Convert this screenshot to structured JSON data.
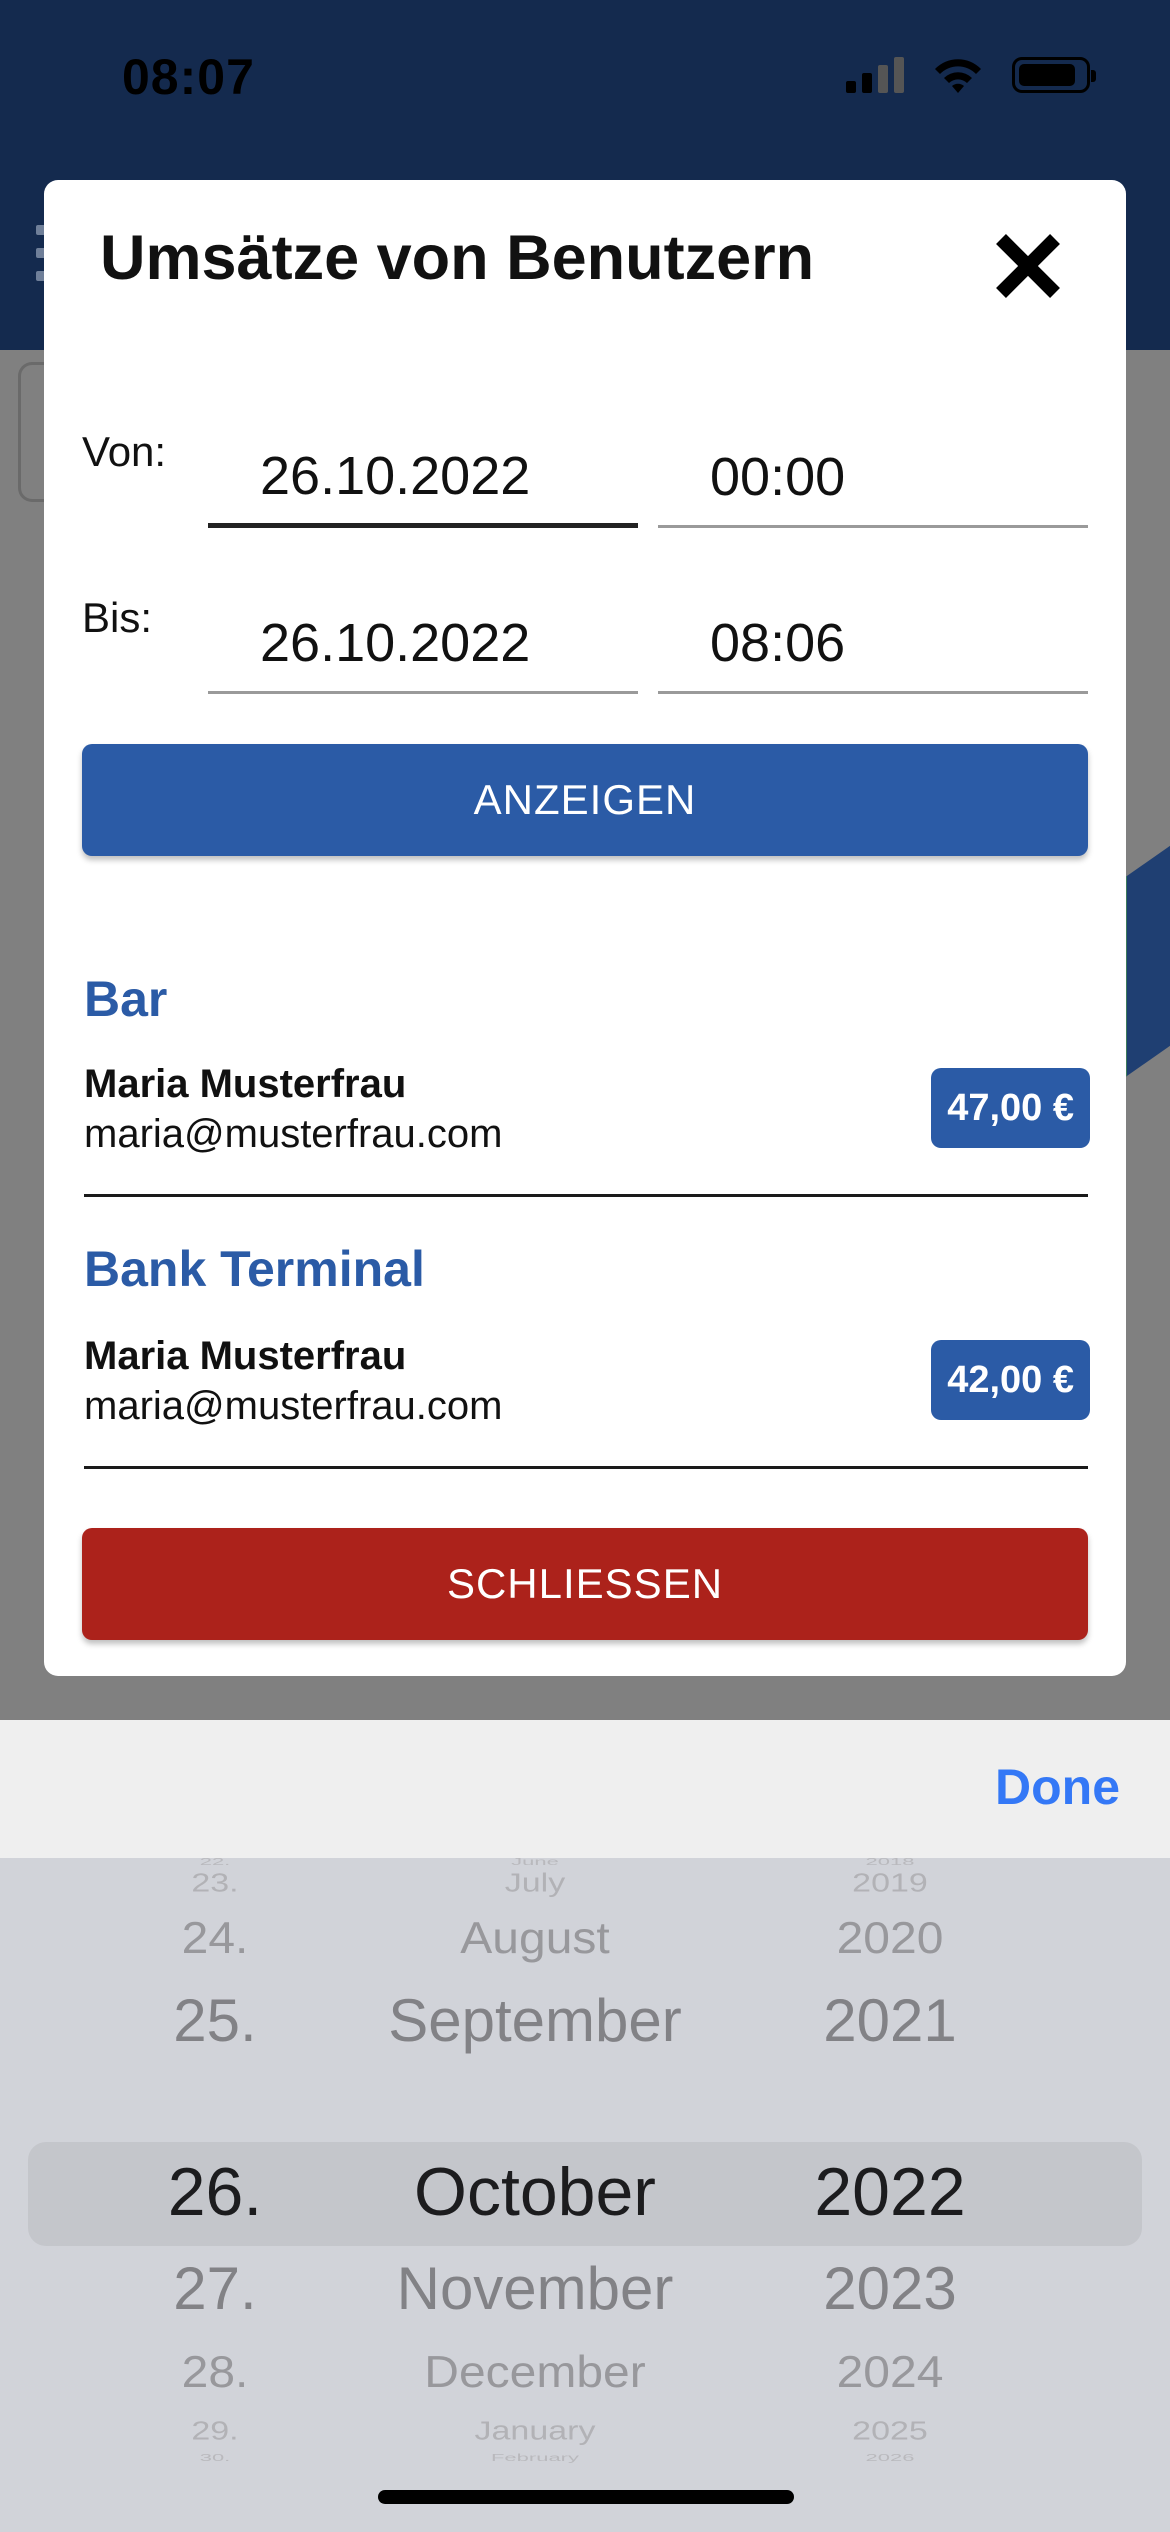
{
  "status_bar": {
    "time": "08:07"
  },
  "modal": {
    "title": "Umsätze von Benutzern",
    "from": {
      "label": "Von:",
      "date": "26.10.2022",
      "time": "00:00"
    },
    "to": {
      "label": "Bis:",
      "date": "26.10.2022",
      "time": "08:06"
    },
    "show_button": "ANZEIGEN",
    "close_button": "SCHLIESSEN",
    "sections": [
      {
        "title": "Bar",
        "name": "Maria Musterfrau",
        "email": "maria@musterfrau.com",
        "amount": "47,00 €"
      },
      {
        "title": "Bank Terminal",
        "name": "Maria Musterfrau",
        "email": "maria@musterfrau.com",
        "amount": "42,00 €"
      }
    ]
  },
  "picker": {
    "done_label": "Done",
    "days": [
      "22.",
      "23.",
      "24.",
      "25.",
      "26.",
      "27.",
      "28.",
      "29.",
      "30."
    ],
    "months": [
      "June",
      "July",
      "August",
      "September",
      "October",
      "November",
      "December",
      "January",
      "February"
    ],
    "years": [
      "2018",
      "2019",
      "2020",
      "2021",
      "2022",
      "2023",
      "2024",
      "2025",
      "2026"
    ],
    "selected_index": 4
  },
  "colors": {
    "accent_blue": "#2b5ba6",
    "danger_red": "#ac221b",
    "header_navy": "#142a4e",
    "ios_blue": "#3478f6"
  }
}
